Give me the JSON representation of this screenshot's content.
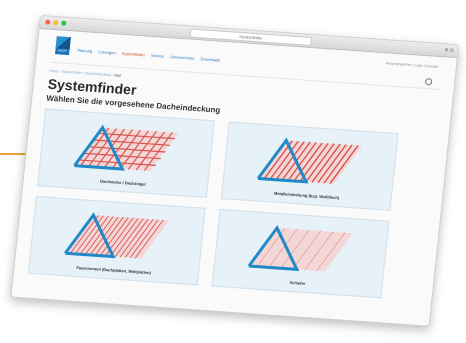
{
  "colors": {
    "accent": "#e9a23b",
    "roof_outline": "#1f8ac7",
    "roof_fill": "#f3d7d7",
    "roof_stripe": "#d9534f"
  },
  "browser": {
    "url": "Systemfinder"
  },
  "header": {
    "logo_text": "DACH",
    "nav": [
      {
        "label": "Planung",
        "active": false
      },
      {
        "label": "Lösungen",
        "active": false
      },
      {
        "label": "Systemfinder",
        "active": true
      },
      {
        "label": "Service",
        "active": false
      },
      {
        "label": "Unternehmen",
        "active": false
      },
      {
        "label": "Downloads",
        "active": false
      }
    ],
    "top_right": "Ansprechpartner | Login | Kontakt"
  },
  "breadcrumb": {
    "path": "Home › Systemfinder › Dacheindeckung ›",
    "current": "Steil"
  },
  "page": {
    "title": "Systemfinder",
    "subtitle": "Wählen Sie die vorgesehene Dacheindeckung"
  },
  "cards": [
    {
      "label": "Dachsteine / Dachziegel",
      "icon": "tiled-roof-icon"
    },
    {
      "label": "Metalleindeckung (bsp. Wellblech)",
      "icon": "metal-roof-icon"
    },
    {
      "label": "Faserzement (Dachplatten, Wellplatten)",
      "icon": "fibercement-roof-icon"
    },
    {
      "label": "Schiefer",
      "icon": "slate-roof-icon"
    }
  ]
}
